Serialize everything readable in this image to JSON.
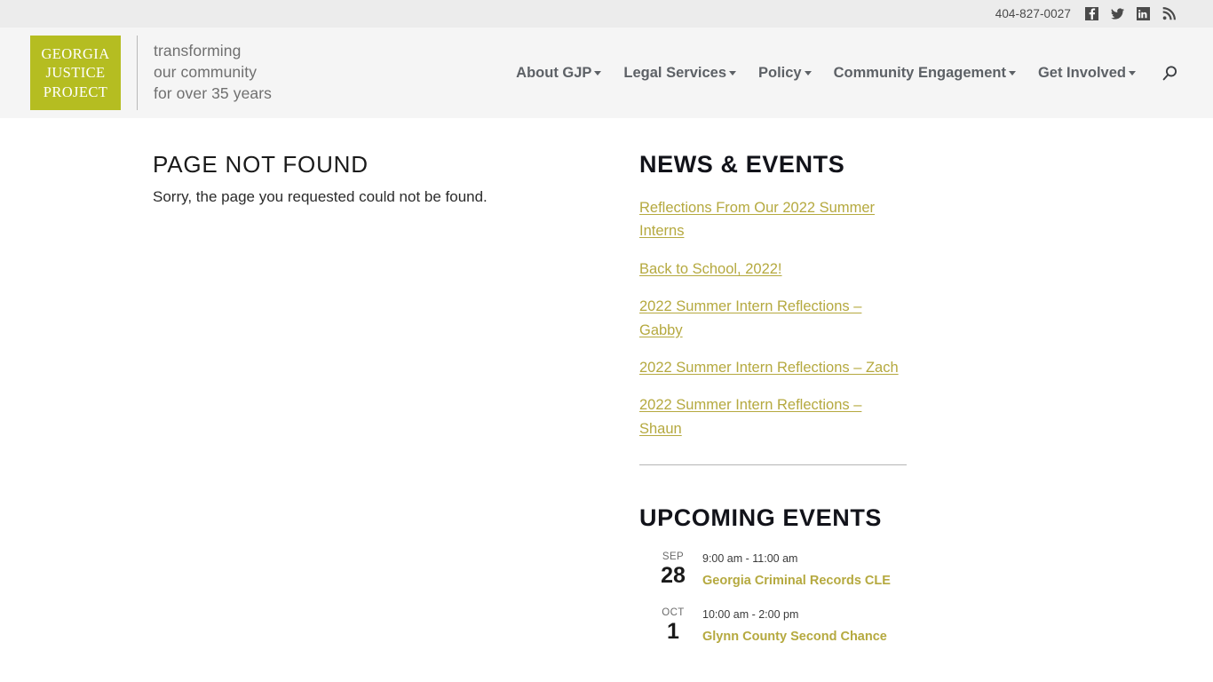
{
  "topbar": {
    "phone": "404-827-0027",
    "social": [
      {
        "name": "facebook-icon",
        "label": "Facebook"
      },
      {
        "name": "twitter-icon",
        "label": "Twitter"
      },
      {
        "name": "linkedin-icon",
        "label": "LinkedIn"
      },
      {
        "name": "rss-icon",
        "label": "RSS Feed"
      }
    ]
  },
  "brand": {
    "logo_line1": "GEORGIA",
    "logo_line2": "JUSTICE",
    "logo_line3": "PROJECT",
    "tagline_line1": "transforming",
    "tagline_line2": "our community",
    "tagline_line3": "for over 35 years",
    "logo_color": "#b5bd21"
  },
  "nav": {
    "items": [
      {
        "label": "About GJP",
        "has_dropdown": true
      },
      {
        "label": "Legal Services",
        "has_dropdown": true
      },
      {
        "label": "Policy",
        "has_dropdown": true
      },
      {
        "label": "Community Engagement",
        "has_dropdown": true
      },
      {
        "label": "Get Involved",
        "has_dropdown": true
      }
    ],
    "search_icon": "search-icon"
  },
  "main": {
    "title": "Page Not Found",
    "message": "Sorry, the page you requested could not be found."
  },
  "sidebar": {
    "news": {
      "title": "News & Events",
      "items": [
        {
          "label": "Reflections From Our 2022 Summer Interns"
        },
        {
          "label": "Back to School, 2022!"
        },
        {
          "label": "2022 Summer Intern Reflections – Gabby"
        },
        {
          "label": "2022 Summer Intern Reflections – Zach"
        },
        {
          "label": "2022 Summer Intern Reflections – Shaun"
        }
      ]
    },
    "upcoming": {
      "title": "Upcoming Events",
      "events": [
        {
          "month": "SEP",
          "day": "28",
          "time": "9:00 am - 11:00 am",
          "name": "Georgia Criminal Records CLE"
        },
        {
          "month": "OCT",
          "day": "1",
          "time": "10:00 am - 2:00 pm",
          "name": "Glynn County Second Chance"
        }
      ]
    },
    "link_color": "#b5a93f"
  }
}
